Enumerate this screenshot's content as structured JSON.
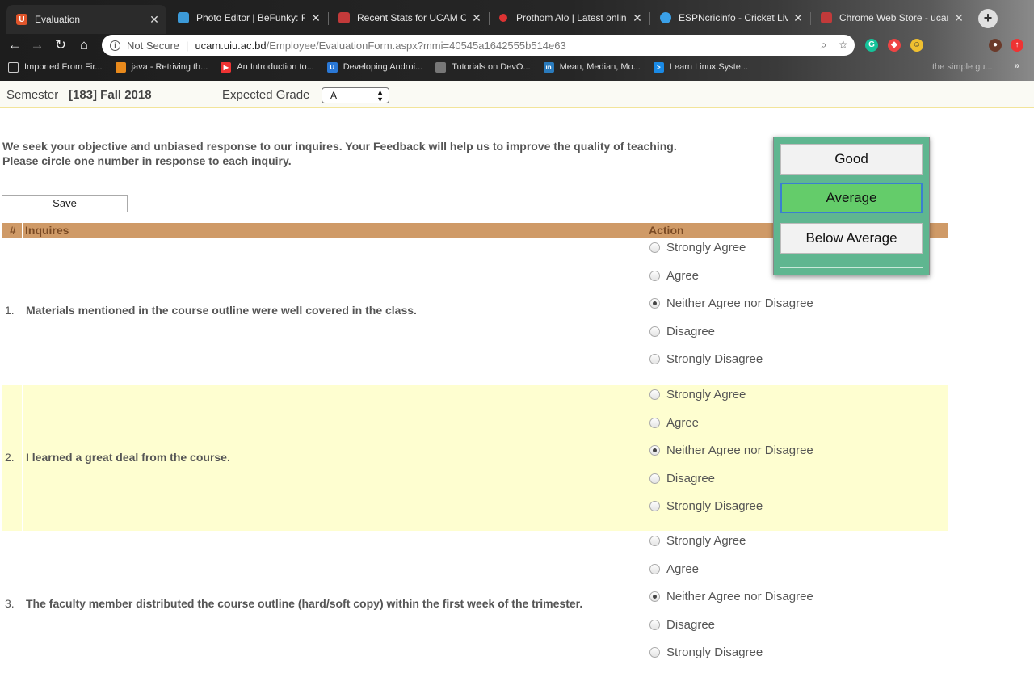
{
  "browser": {
    "tabs": [
      {
        "title": "Evaluation",
        "favicon_color": "#e0552b",
        "favicon_text": "U"
      },
      {
        "title": "Photo Editor | BeFunky: Free",
        "favicon_color": "#3c9ad8",
        "favicon_text": ""
      },
      {
        "title": "Recent Stats for UCAM Cour",
        "favicon_color": "#c23a3a",
        "favicon_text": ""
      },
      {
        "title": "Prothom Alo | Latest online",
        "favicon_color": "#d33",
        "favicon_text": ""
      },
      {
        "title": "ESPNcricinfo - Cricket Live",
        "favicon_color": "#3aa0e8",
        "favicon_text": ""
      },
      {
        "title": "Chrome Web Store - ucam",
        "favicon_color": "#c23a3a",
        "favicon_text": ""
      }
    ],
    "new_tab": "+",
    "omnibox": {
      "security": "Not Secure",
      "host": "ucam.uiu.ac.bd",
      "path": "/Employee/EvaluationForm.aspx?mmi=40545a1642555b514e63"
    },
    "bookmarks": [
      {
        "label": "Imported From Fir...",
        "icon_color": "#888"
      },
      {
        "label": "java - Retriving th...",
        "icon_color": "#e98a1c"
      },
      {
        "label": "An Introduction to...",
        "icon_color": "#e33"
      },
      {
        "label": "Developing Androi...",
        "icon_color": "#2a78d6"
      },
      {
        "label": "Tutorials on DevO...",
        "icon_color": "#777"
      },
      {
        "label": "Mean, Median, Mo...",
        "icon_color": "#2a7bbd"
      },
      {
        "label": "Learn Linux Syste...",
        "icon_color": "#1a8ae6"
      }
    ],
    "bookmark_partial": "the simple gu..."
  },
  "form": {
    "semester_label": "Semester",
    "semester_value": "[183] Fall 2018",
    "grade_label": "Expected Grade",
    "grade_value": "A",
    "intro_line1": "We seek your objective and unbiased response to our inquires. Your Feedback will help us to improve the quality of teaching.",
    "intro_line2": "Please circle one number in response to each inquiry.",
    "save_label": "Save",
    "header": {
      "num": "#",
      "inquires": "Inquires",
      "action": "Action"
    },
    "options": [
      "Strongly Agree",
      "Agree",
      "Neither Agree nor Disagree",
      "Disagree",
      "Strongly Disagree"
    ],
    "questions": [
      {
        "num": "1.",
        "text": "Materials mentioned in the course outline were well covered in the class.",
        "selected": 2
      },
      {
        "num": "2.",
        "text": "I learned a great deal from the course.",
        "selected": 2
      },
      {
        "num": "3.",
        "text": "The faculty member distributed the course outline (hard/soft copy) within the first week of the trimester.",
        "selected": 2
      }
    ]
  },
  "popup": {
    "options": [
      "Good",
      "Average",
      "Below Average"
    ],
    "selected": 1
  }
}
